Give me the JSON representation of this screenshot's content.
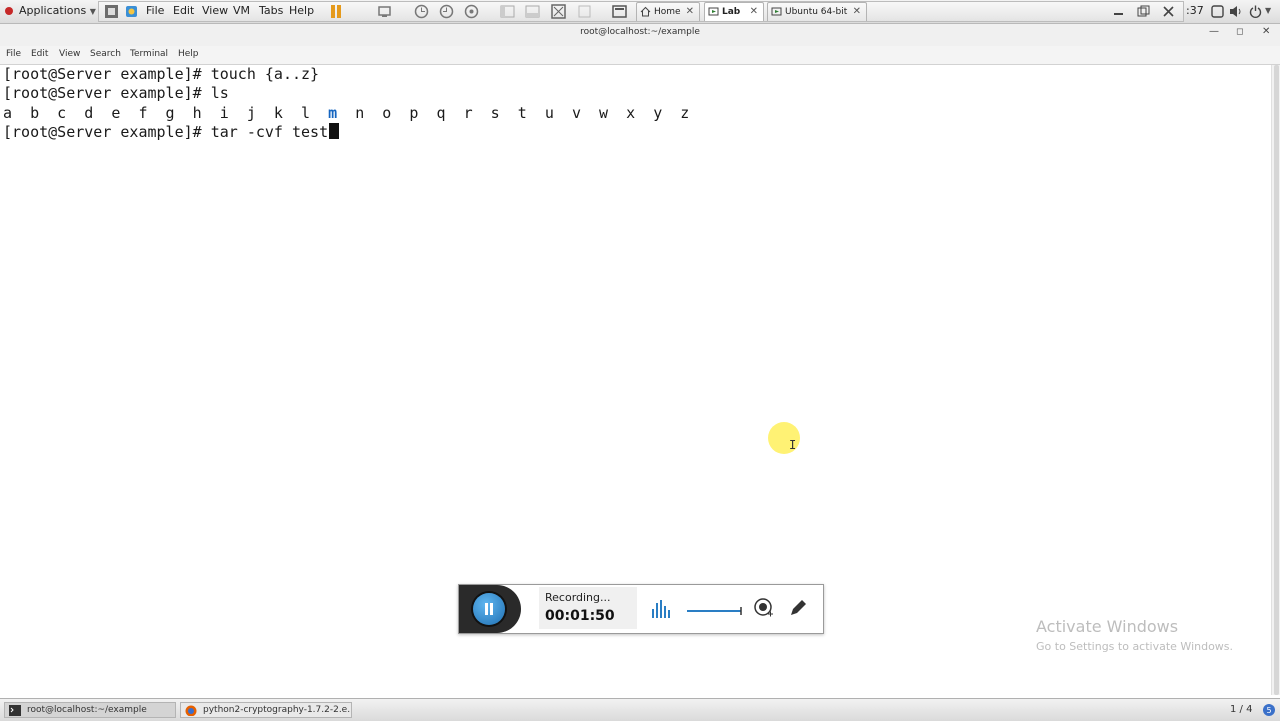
{
  "topbar": {
    "applications_label": "Applications",
    "vm_menu": [
      "File",
      "Edit",
      "View",
      "VM",
      "Tabs",
      "Help"
    ],
    "vm_tabs": [
      {
        "label": "Home",
        "active": false
      },
      {
        "label": "Lab",
        "active": true
      },
      {
        "label": "Ubuntu 64-bit",
        "active": false
      }
    ],
    "clock": ":37"
  },
  "window": {
    "title": "root@localhost:~/example"
  },
  "terminal_menu": [
    "File",
    "Edit",
    "View",
    "Search",
    "Terminal",
    "Help"
  ],
  "terminal": {
    "lines": [
      "[root@Server example]# touch {a..z}",
      "[root@Server example]# ls",
      "a  b  c  d  e  f  g  h  i  j  k  l  m  n  o  p  q  r  s  t  u  v  w  x  y  z",
      "[root@Server example]# tar -cvf test"
    ]
  },
  "recorder": {
    "status": "Recording...",
    "elapsed": "00:01:50"
  },
  "watermark": {
    "title": "Activate Windows",
    "subtitle": "Go to Settings to activate Windows."
  },
  "taskbar": {
    "tasks": [
      "root@localhost:~/example",
      "python2-cryptography-1.7.2-2.e..."
    ],
    "workspace": "1 / 4"
  },
  "colors": {
    "accent_blue": "#1f6fb2",
    "highlight": "#ffee46",
    "ls_mark_blue": "#1565c0"
  }
}
